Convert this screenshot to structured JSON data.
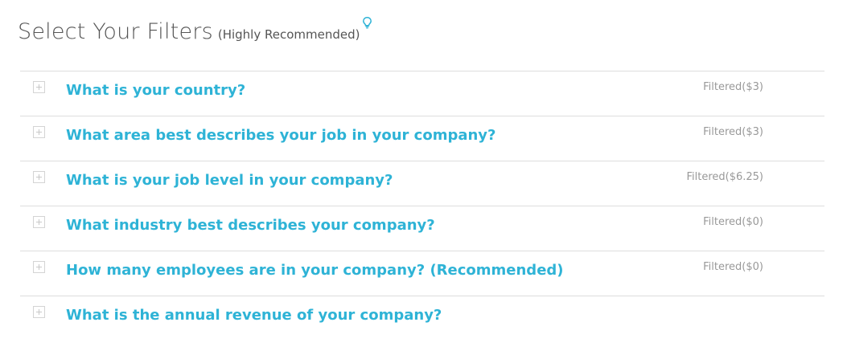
{
  "header": {
    "title": "Select Your Filters",
    "subtitle": "(Highly Recommended)",
    "hint_icon": "lightbulb-icon",
    "accent_color": "#2eb3d6"
  },
  "filters": [
    {
      "question": "What is your country?",
      "status": "Filtered($3)"
    },
    {
      "question": "What area best describes your job in your company?",
      "status": "Filtered($3)"
    },
    {
      "question": "What is your job level in your company?",
      "status": "Filtered($6.25)"
    },
    {
      "question": "What industry best describes your company?",
      "status": "Filtered($0)"
    },
    {
      "question": "How many employees are in your company? (Recommended)",
      "status": "Filtered($0)"
    },
    {
      "question": "What is the annual revenue of your company?",
      "status": ""
    }
  ],
  "icons": {
    "expand": "plus-square-icon"
  }
}
